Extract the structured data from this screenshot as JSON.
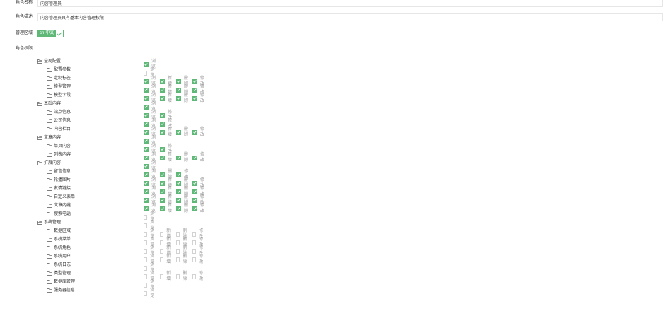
{
  "form": {
    "role_name_label": "角色名称",
    "role_name_value": "内容管理员",
    "role_desc_label": "角色描述",
    "role_desc_value": "内容管理员具有基本内容管理权限",
    "area_label": "管理区域",
    "area_tag": "cn-中文",
    "perms_label": "角色权限"
  },
  "colors": {
    "accent": "#5fb878",
    "unchecked_border": "#d2d2d2",
    "text": "#333333",
    "muted": "#999999"
  },
  "icons": {
    "group": "folder-open-icon",
    "leaf": "folder-icon",
    "check": "check-icon"
  },
  "tree": [
    {
      "label": "全局配置",
      "level": 0,
      "perms": [
        {
          "label": "浏览",
          "checked": true
        }
      ]
    },
    {
      "label": "配置参数",
      "level": 1,
      "perms": [
        {
          "label": "浏览",
          "checked": false
        }
      ]
    },
    {
      "label": "定制标签",
      "level": 1,
      "perms": [
        {
          "label": "浏览",
          "checked": true
        },
        {
          "label": "新增",
          "checked": true
        },
        {
          "label": "删除",
          "checked": true
        },
        {
          "label": "修改",
          "checked": true
        }
      ]
    },
    {
      "label": "模型管理",
      "level": 1,
      "perms": [
        {
          "label": "浏览",
          "checked": true
        },
        {
          "label": "新增",
          "checked": true
        },
        {
          "label": "删除",
          "checked": true
        },
        {
          "label": "修改",
          "checked": true
        }
      ]
    },
    {
      "label": "模型字段",
      "level": 1,
      "perms": [
        {
          "label": "浏览",
          "checked": true
        },
        {
          "label": "新增",
          "checked": true
        },
        {
          "label": "删除",
          "checked": true
        },
        {
          "label": "修改",
          "checked": true
        }
      ]
    },
    {
      "label": "基础内容",
      "level": 0,
      "perms": [
        {
          "label": "浏览",
          "checked": true
        }
      ]
    },
    {
      "label": "站点信息",
      "level": 1,
      "perms": [
        {
          "label": "浏览",
          "checked": true
        },
        {
          "label": "修改",
          "checked": true
        }
      ]
    },
    {
      "label": "公司信息",
      "level": 1,
      "perms": [
        {
          "label": "浏览",
          "checked": true
        },
        {
          "label": "修改",
          "checked": true
        }
      ]
    },
    {
      "label": "内容栏目",
      "level": 1,
      "perms": [
        {
          "label": "浏览",
          "checked": true
        },
        {
          "label": "新增",
          "checked": true
        },
        {
          "label": "删除",
          "checked": true
        },
        {
          "label": "修改",
          "checked": true
        }
      ]
    },
    {
      "label": "文章内容",
      "level": 0,
      "perms": [
        {
          "label": "浏览",
          "checked": true
        }
      ]
    },
    {
      "label": "单页内容",
      "level": 1,
      "perms": [
        {
          "label": "浏览",
          "checked": true
        },
        {
          "label": "修改",
          "checked": true
        }
      ]
    },
    {
      "label": "列表内容",
      "level": 1,
      "perms": [
        {
          "label": "浏览",
          "checked": true
        },
        {
          "label": "新增",
          "checked": true
        },
        {
          "label": "删除",
          "checked": true
        },
        {
          "label": "修改",
          "checked": true
        }
      ]
    },
    {
      "label": "扩展内容",
      "level": 0,
      "perms": [
        {
          "label": "浏览",
          "checked": true
        }
      ]
    },
    {
      "label": "留言信息",
      "level": 1,
      "perms": [
        {
          "label": "浏览",
          "checked": true
        },
        {
          "label": "删除",
          "checked": true
        },
        {
          "label": "修改",
          "checked": true
        }
      ]
    },
    {
      "label": "轮播图片",
      "level": 1,
      "perms": [
        {
          "label": "浏览",
          "checked": true
        },
        {
          "label": "新增",
          "checked": true
        },
        {
          "label": "删除",
          "checked": true
        },
        {
          "label": "修改",
          "checked": true
        }
      ]
    },
    {
      "label": "友情链接",
      "level": 1,
      "perms": [
        {
          "label": "浏览",
          "checked": true
        },
        {
          "label": "新增",
          "checked": true
        },
        {
          "label": "删除",
          "checked": true
        },
        {
          "label": "修改",
          "checked": true
        }
      ]
    },
    {
      "label": "自定义表单",
      "level": 1,
      "perms": [
        {
          "label": "浏览",
          "checked": true
        },
        {
          "label": "新增",
          "checked": true
        },
        {
          "label": "删除",
          "checked": true
        },
        {
          "label": "修改",
          "checked": true
        }
      ]
    },
    {
      "label": "文章内链",
      "level": 1,
      "perms": [
        {
          "label": "浏览",
          "checked": true
        },
        {
          "label": "新增",
          "checked": true
        },
        {
          "label": "删除",
          "checked": true
        },
        {
          "label": "修改",
          "checked": true
        }
      ]
    },
    {
      "label": "搜索电话",
      "level": 1,
      "perms": [
        {
          "label": "浏览",
          "checked": false
        }
      ]
    },
    {
      "label": "系统管理",
      "level": 0,
      "perms": [
        {
          "label": "浏览",
          "checked": false
        }
      ]
    },
    {
      "label": "数据区域",
      "level": 1,
      "perms": [
        {
          "label": "浏览",
          "checked": false
        },
        {
          "label": "新增",
          "checked": false
        },
        {
          "label": "删除",
          "checked": false
        },
        {
          "label": "修改",
          "checked": false
        }
      ]
    },
    {
      "label": "系统菜单",
      "level": 1,
      "perms": [
        {
          "label": "浏览",
          "checked": false
        },
        {
          "label": "新增",
          "checked": false
        },
        {
          "label": "删除",
          "checked": false
        },
        {
          "label": "修改",
          "checked": false
        }
      ]
    },
    {
      "label": "系统角色",
      "level": 1,
      "perms": [
        {
          "label": "浏览",
          "checked": false
        },
        {
          "label": "新增",
          "checked": false
        },
        {
          "label": "删除",
          "checked": false
        },
        {
          "label": "修改",
          "checked": false
        }
      ]
    },
    {
      "label": "系统用户",
      "level": 1,
      "perms": [
        {
          "label": "浏览",
          "checked": false
        },
        {
          "label": "新增",
          "checked": false
        },
        {
          "label": "删除",
          "checked": false
        },
        {
          "label": "修改",
          "checked": false
        }
      ]
    },
    {
      "label": "系统日志",
      "level": 1,
      "perms": [
        {
          "label": "浏览",
          "checked": false
        }
      ]
    },
    {
      "label": "类型管理",
      "level": 1,
      "perms": [
        {
          "label": "浏览",
          "checked": false
        },
        {
          "label": "新增",
          "checked": false
        },
        {
          "label": "删除",
          "checked": false
        },
        {
          "label": "修改",
          "checked": false
        }
      ]
    },
    {
      "label": "数据库管理",
      "level": 1,
      "perms": [
        {
          "label": "浏览",
          "checked": false
        }
      ]
    },
    {
      "label": "服务器信息",
      "level": 1,
      "perms": [
        {
          "label": "浏览",
          "checked": false
        }
      ]
    }
  ]
}
